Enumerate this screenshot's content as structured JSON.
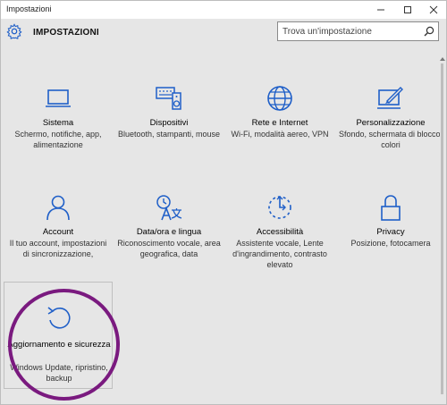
{
  "window": {
    "title": "Impostazioni"
  },
  "header": {
    "title": "IMPOSTAZIONI",
    "search_placeholder": "Trova un'impostazione"
  },
  "tiles": [
    {
      "name": "Sistema",
      "desc": "Schermo, notifiche, app, alimentazione",
      "icon": "laptop-icon"
    },
    {
      "name": "Dispositivi",
      "desc": "Bluetooth, stampanti, mouse",
      "icon": "devices-icon"
    },
    {
      "name": "Rete e Internet",
      "desc": "Wi-Fi, modalità aereo, VPN",
      "icon": "globe-icon"
    },
    {
      "name": "Personalizzazione",
      "desc": "Sfondo, schermata di blocco, colori",
      "icon": "personalization-icon"
    },
    {
      "name": "Account",
      "desc": "Il tuo account, impostazioni di sincronizzazione,",
      "icon": "person-icon"
    },
    {
      "name": "Data/ora e lingua",
      "desc": "Riconoscimento vocale, area geografica, data",
      "icon": "language-icon"
    },
    {
      "name": "Accessibilità",
      "desc": "Assistente vocale, Lente d'ingrandimento, contrasto elevato",
      "icon": "accessibility-icon"
    },
    {
      "name": "Privacy",
      "desc": "Posizione, fotocamera",
      "icon": "lock-icon"
    },
    {
      "name": "Aggiornamento e sicurezza",
      "desc": "Windows Update, ripristino, backup",
      "icon": "update-icon"
    }
  ],
  "colors": {
    "accent": "#1f5fc8",
    "highlight_circle": "#7a1a7f",
    "background": "#e6e6e6"
  }
}
